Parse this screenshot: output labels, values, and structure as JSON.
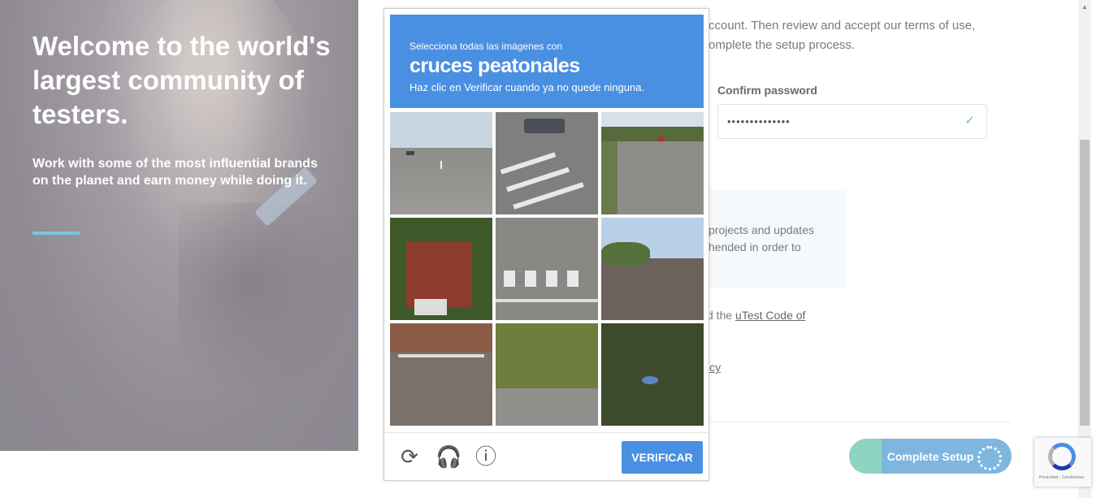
{
  "hero": {
    "title": "Welcome to the world's largest community of testers.",
    "subtitle": "Work with some of the most influential brands on the planet and earn money while doing it."
  },
  "form": {
    "intro_text": "ccount. Then review and accept our terms of use, omplete the setup process.",
    "confirm_password_label": "Confirm password",
    "confirm_password_value": "••••••••••••••",
    "notice_line1": "projects and updates",
    "notice_line2": "hended in order to",
    "code_prefix": "d the ",
    "code_link": "uTest Code of",
    "policy_link": "icy",
    "complete_button": "Complete Setup"
  },
  "captcha": {
    "instruction_small": "Selecciona todas las imágenes con",
    "instruction_big": "cruces peatonales",
    "instruction_sub": "Haz clic en Verificar cuando ya no quede ninguna.",
    "verify_button": "VERIFICAR",
    "reload_icon": "reload-icon",
    "audio_icon": "headphones-icon",
    "info_icon": "info-icon",
    "tiles": [
      {
        "scene": "road with cars"
      },
      {
        "scene": "crosswalk with truck"
      },
      {
        "scene": "highway with trees"
      },
      {
        "scene": "brick house"
      },
      {
        "scene": "crosswalk intersection"
      },
      {
        "scene": "house roof"
      },
      {
        "scene": "town street"
      },
      {
        "scene": "hedge and road"
      },
      {
        "scene": "trees"
      }
    ]
  },
  "recaptcha_badge": {
    "text": "Privacidad - Condiciones"
  },
  "colors": {
    "captcha_blue": "#4a90e2",
    "hero_accent": "#7cc4e4",
    "check_green": "#67c5a8"
  }
}
